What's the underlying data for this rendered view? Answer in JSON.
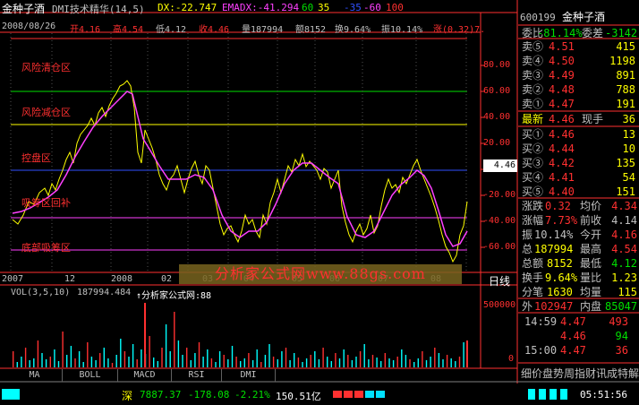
{
  "header": {
    "stock_name": "金种子酒",
    "indicator": "DMI技术精华(14,5)",
    "dx": "DX:-22.747",
    "emadx": "EMADX:-41.294",
    "levels": [
      "60",
      "35",
      "-35",
      "-60",
      "100"
    ],
    "info": {
      "date": "2008/08/26",
      "open": "开4.16",
      "high": "高4.54",
      "low": "低4.12",
      "close": "收4.46",
      "volume": "量187994",
      "amount": "额8152",
      "turnover": "换9.64%",
      "amplitude": "振10.14%",
      "change": "涨(0.32)7."
    }
  },
  "zones": [
    "风险清仓区",
    "风险减仓区",
    "控盘区",
    "吸筹区回补",
    "底部吸筹区"
  ],
  "y_axis": [
    "80.00",
    "60.00",
    "40.00",
    "20.00",
    "0.00",
    "-20.00",
    "-40.00",
    "-60.00"
  ],
  "price_tag": "4.46",
  "x_axis": [
    "2007",
    "12",
    "2008",
    "02",
    "03",
    "04",
    "05",
    "06",
    "07",
    "08"
  ],
  "period_label": "日线",
  "vol": {
    "label": "VOL(3,5,10)",
    "value": "187994.484",
    "mark": "↑分析家公式网:88",
    "axis": [
      "500000",
      "0"
    ]
  },
  "tabs": [
    "MA",
    "BOLL",
    "MACD",
    "RSI",
    "DMI"
  ],
  "watermark": "分析家公式网www.88gs.com",
  "status": {
    "index_name": "深",
    "index_value": "7887.37",
    "index_change": "-178.08",
    "index_pct": "-2.21%",
    "amount": "150.51亿",
    "time": "05:51:56"
  },
  "quote": {
    "code": "600199",
    "name": "金种子酒",
    "ratio_label": "委比",
    "ratio": "-81.14%",
    "diff_label": "委差",
    "diff": "-3142",
    "sells": [
      {
        "label": "卖⑤",
        "price": "4.51",
        "vol": "415"
      },
      {
        "label": "卖④",
        "price": "4.50",
        "vol": "1198"
      },
      {
        "label": "卖③",
        "price": "4.49",
        "vol": "891"
      },
      {
        "label": "卖②",
        "price": "4.48",
        "vol": "788"
      },
      {
        "label": "卖①",
        "price": "4.47",
        "vol": "191"
      }
    ],
    "last_label": "最新",
    "last": "4.46",
    "hand_label": "现手",
    "hand": "36",
    "buys": [
      {
        "label": "买①",
        "price": "4.46",
        "vol": "13"
      },
      {
        "label": "买②",
        "price": "4.44",
        "vol": "10"
      },
      {
        "label": "买③",
        "price": "4.42",
        "vol": "135"
      },
      {
        "label": "买④",
        "price": "4.41",
        "vol": "54"
      },
      {
        "label": "买⑤",
        "price": "4.40",
        "vol": "151"
      }
    ],
    "stats": [
      {
        "l1": "涨跌",
        "v1": "0.32",
        "l2": "均价",
        "v2": "4.34"
      },
      {
        "l1": "涨幅",
        "v1": "7.73%",
        "l2": "前收",
        "v2": "4.14"
      },
      {
        "l1": "振",
        "v1": "10.14%",
        "l2": "今开",
        "v2": "4.16"
      },
      {
        "l1": "总",
        "v1": "187994",
        "l2": "最高",
        "v2": "4.54"
      },
      {
        "l1": "总额",
        "v1": "8152",
        "l2": "最低",
        "v2": "4.12"
      },
      {
        "l1": "换手",
        "v1": "9.64%",
        "l2": "量比",
        "v2": "1.23"
      },
      {
        "l1": "分笔",
        "v1": "1630",
        "l2": "均量",
        "v2": "115"
      }
    ],
    "outer_label": "外",
    "outer": "102947",
    "inner_label": "内盘",
    "inner": "85047",
    "ticks": [
      {
        "time": "14:59",
        "price": "4.47",
        "vol": "493"
      },
      {
        "time": "",
        "price": "4.46",
        "vol": "94"
      },
      {
        "time": "15:00",
        "price": "4.47",
        "vol": "36"
      }
    ],
    "bottom": "细价盘势周指财讯成特解"
  },
  "colors": {
    "red": "#ff3030",
    "green": "#00e000",
    "yellow": "#ffff00",
    "magenta": "#ff40ff",
    "cyan": "#00ffff",
    "blue": "#3050ff",
    "white": "#ffffff",
    "grid": "#808000"
  }
}
